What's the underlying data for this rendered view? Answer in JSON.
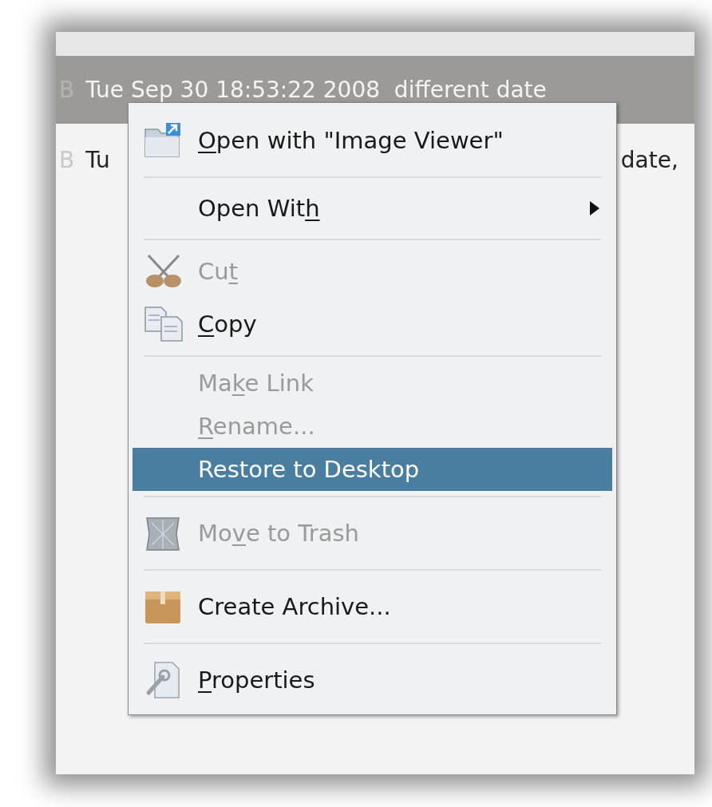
{
  "file_rows": [
    {
      "size": "B",
      "selected": true,
      "segments": [
        "Tue Sep 30 18:53:22 2008  different date"
      ]
    },
    {
      "size": "B",
      "selected": false,
      "segments": [
        "Tu",
        "date,"
      ]
    }
  ],
  "context_menu": {
    "items": [
      {
        "kind": "item",
        "key": "O",
        "post": "pen with \"Image Viewer\"",
        "disabled": false,
        "selected": false,
        "submenu": false
      },
      {
        "kind": "separator"
      },
      {
        "kind": "item",
        "pre": "Open Wit",
        "key": "h",
        "disabled": false,
        "selected": false,
        "submenu": true
      },
      {
        "kind": "separator"
      },
      {
        "kind": "item",
        "pre": "Cu",
        "key": "t",
        "disabled": true,
        "selected": false,
        "submenu": false
      },
      {
        "kind": "item",
        "key": "C",
        "post": "opy",
        "disabled": false,
        "selected": false,
        "submenu": false
      },
      {
        "kind": "separator"
      },
      {
        "kind": "item",
        "pre": "Ma",
        "key": "k",
        "post": "e Link",
        "disabled": true,
        "selected": false,
        "submenu": false
      },
      {
        "kind": "item",
        "key": "R",
        "post": "ename...",
        "disabled": true,
        "selected": false,
        "submenu": false
      },
      {
        "kind": "item",
        "pre": "Restore to Desktop",
        "disabled": false,
        "selected": true,
        "submenu": false
      },
      {
        "kind": "separator"
      },
      {
        "kind": "item",
        "pre": "Mo",
        "key": "v",
        "post": "e to Trash",
        "disabled": true,
        "selected": false,
        "submenu": false
      },
      {
        "kind": "separator"
      },
      {
        "kind": "item",
        "pre": "Create Archive...",
        "disabled": false,
        "selected": false,
        "submenu": false
      },
      {
        "kind": "separator"
      },
      {
        "kind": "item",
        "key": "P",
        "post": "roperties",
        "disabled": false,
        "selected": false,
        "submenu": false
      }
    ]
  }
}
